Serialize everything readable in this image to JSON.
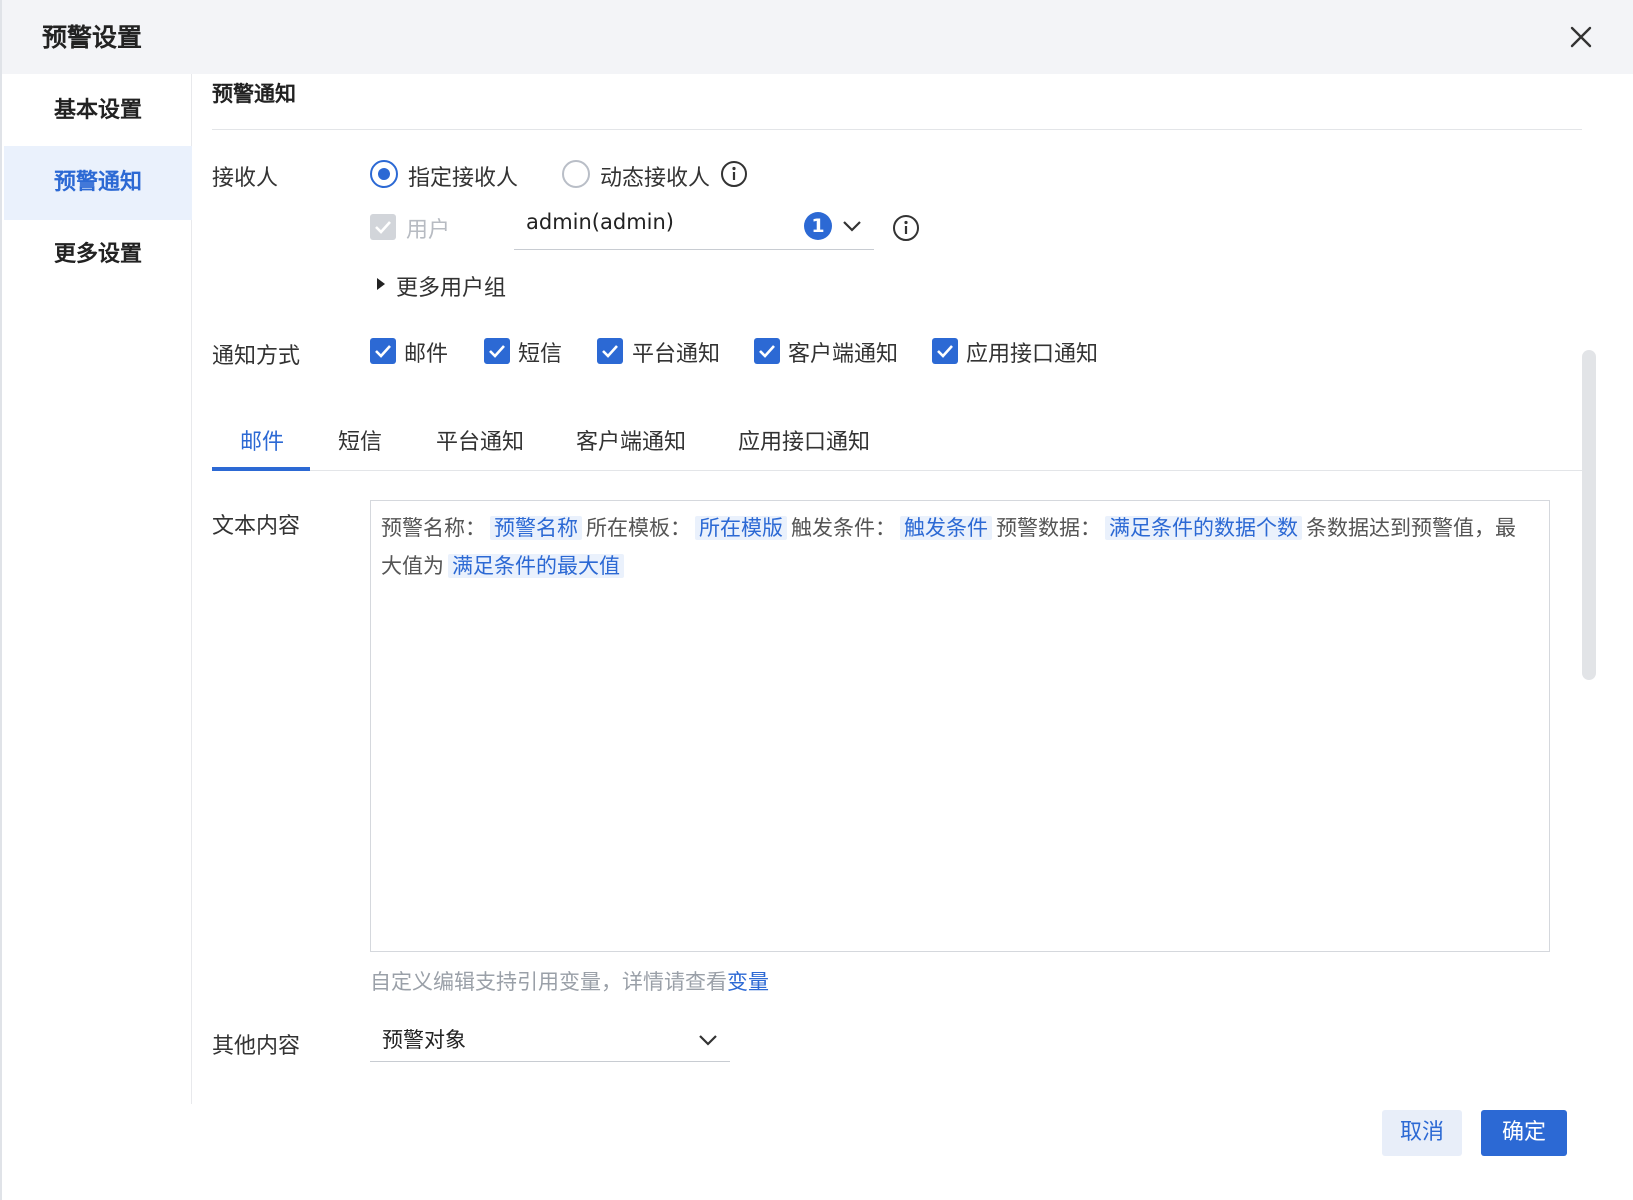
{
  "dialog": {
    "title": "预警设置"
  },
  "sidebar": {
    "items": [
      {
        "label": "基本设置"
      },
      {
        "label": "预警通知"
      },
      {
        "label": "更多设置"
      }
    ]
  },
  "section": {
    "title": "预警通知"
  },
  "receiver": {
    "label": "接收人",
    "options": [
      "指定接收人",
      "动态接收人"
    ],
    "selected": "指定接收人",
    "user_checkbox_label": "用户",
    "user_value": "admin(admin)",
    "user_count": "1",
    "more_groups": "更多用户组"
  },
  "notify": {
    "label": "通知方式",
    "methods": [
      "邮件",
      "短信",
      "平台通知",
      "客户端通知",
      "应用接口通知"
    ]
  },
  "tabs": [
    "邮件",
    "短信",
    "平台通知",
    "客户端通知",
    "应用接口通知"
  ],
  "text_content": {
    "label": "文本内容",
    "t1": "预警名称：",
    "v1": "预警名称",
    "t2": "所在模板：",
    "v2": "所在模版",
    "t3": "触发条件：",
    "v3": "触发条件",
    "t4": "预警数据：",
    "v4": "满足条件的数据个数",
    "t5": "条数据达到预警值，最大值为",
    "v5": "满足条件的最大值"
  },
  "hint": {
    "text": "自定义编辑支持引用变量，详情请查看",
    "link": "变量"
  },
  "other_content": {
    "label": "其他内容",
    "value": "预警对象"
  },
  "footer": {
    "cancel": "取消",
    "ok": "确定"
  },
  "colors": {
    "accent": "#2c69d4",
    "accent_light": "#eaf1fc"
  }
}
